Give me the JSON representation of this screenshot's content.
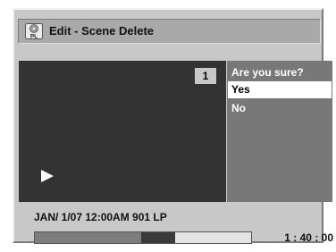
{
  "header": {
    "icon": "pl-disc-icon",
    "icon_text": "PL",
    "title": "Edit - Scene Delete"
  },
  "preview": {
    "scene_number": "1",
    "play_icon": "play-icon"
  },
  "dialog": {
    "question": "Are you sure?",
    "options": [
      {
        "label": "Yes",
        "selected": true
      },
      {
        "label": "No",
        "selected": false
      }
    ]
  },
  "info": {
    "recording": "JAN/ 1/07 12:00AM 901  LP"
  },
  "progress": {
    "window_start": 0.49,
    "window_end": 0.65,
    "time": "1 : 40 : 00"
  },
  "colors": {
    "frame": "#c8c8c8",
    "title_bar": "#a9a9a9",
    "video_background": "#333333",
    "dialog_background": "#787878",
    "selection": "#ffffff"
  }
}
